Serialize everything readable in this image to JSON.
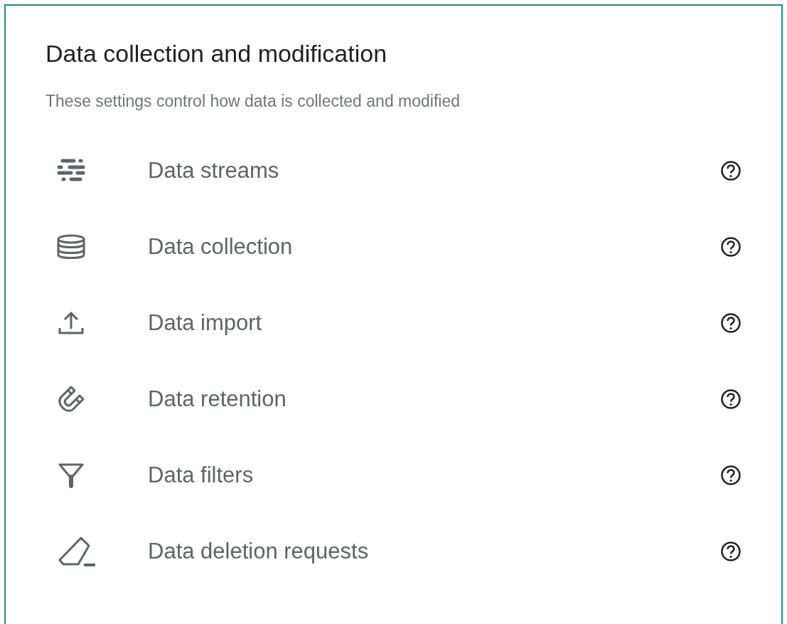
{
  "title": "Data collection and modification",
  "subtitle": "These settings control how data is collected and modified",
  "items": [
    {
      "kind": "streams",
      "label": "Data streams"
    },
    {
      "kind": "database",
      "label": "Data collection"
    },
    {
      "kind": "upload",
      "label": "Data import"
    },
    {
      "kind": "magnet",
      "label": "Data retention"
    },
    {
      "kind": "filter",
      "label": "Data filters"
    },
    {
      "kind": "eraser",
      "label": "Data deletion requests"
    }
  ]
}
